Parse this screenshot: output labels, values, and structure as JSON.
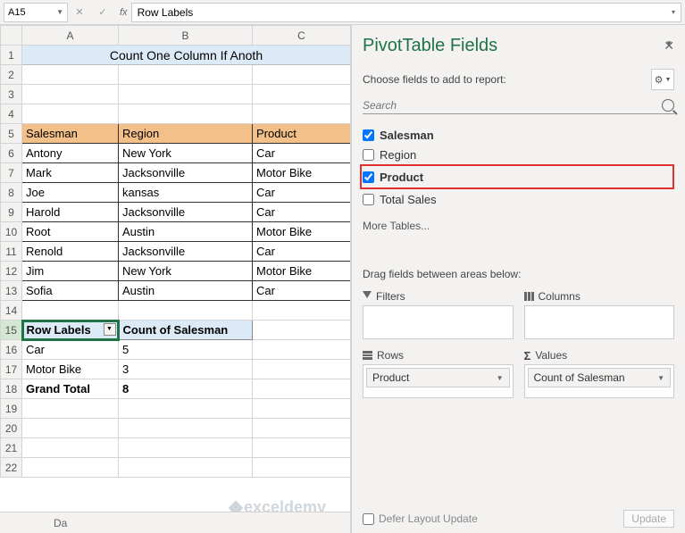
{
  "namebox": {
    "value": "A15"
  },
  "formula_bar": {
    "value": "Row Labels"
  },
  "columns": [
    "A",
    "B",
    "C"
  ],
  "rows": [
    1,
    2,
    3,
    4,
    5,
    6,
    7,
    8,
    9,
    10,
    11,
    12,
    13,
    14,
    15,
    16,
    17,
    18,
    19,
    20,
    21,
    22
  ],
  "title_cell": "Count One Column If Anoth",
  "headers": {
    "A": "Salesman",
    "B": "Region",
    "C": "Product"
  },
  "data_rows": [
    {
      "A": "Antony",
      "B": "New York",
      "C": "Car"
    },
    {
      "A": "Mark",
      "B": "Jacksonville",
      "C": "Motor Bike"
    },
    {
      "A": "Joe",
      "B": "kansas",
      "C": "Car"
    },
    {
      "A": "Harold",
      "B": "Jacksonville",
      "C": "Car"
    },
    {
      "A": "Root",
      "B": "Austin",
      "C": "Motor Bike"
    },
    {
      "A": "Renold",
      "B": "Jacksonville",
      "C": "Car"
    },
    {
      "A": "Jim",
      "B": "New York",
      "C": "Motor Bike"
    },
    {
      "A": "Sofia",
      "B": "Austin",
      "C": "Car"
    }
  ],
  "pivot": {
    "row_labels_hdr": "Row Labels",
    "count_hdr": "Count of Salesman",
    "rows": [
      {
        "label": "Car",
        "count": 5
      },
      {
        "label": "Motor Bike",
        "count": 3
      }
    ],
    "total_label": "Grand Total",
    "total_count": 8
  },
  "panel": {
    "title": "PivotTable Fields",
    "subtitle": "Choose fields to add to report:",
    "search_ph": "Search",
    "fields": [
      {
        "name": "Salesman",
        "checked": true,
        "bold": true,
        "hl": false
      },
      {
        "name": "Region",
        "checked": false,
        "bold": false,
        "hl": false
      },
      {
        "name": "Product",
        "checked": true,
        "bold": true,
        "hl": true
      },
      {
        "name": "Total Sales",
        "checked": false,
        "bold": false,
        "hl": false
      }
    ],
    "more_tables": "More Tables...",
    "drag_label": "Drag fields between areas below:",
    "areas": {
      "filters": "Filters",
      "columns": "Columns",
      "rows": "Rows",
      "values": "Values",
      "rows_pill": "Product",
      "values_pill": "Count of Salesman"
    },
    "defer": "Defer Layout Update",
    "update": "Update"
  },
  "watermark": "exceldemy",
  "sheet_tab": "Da"
}
